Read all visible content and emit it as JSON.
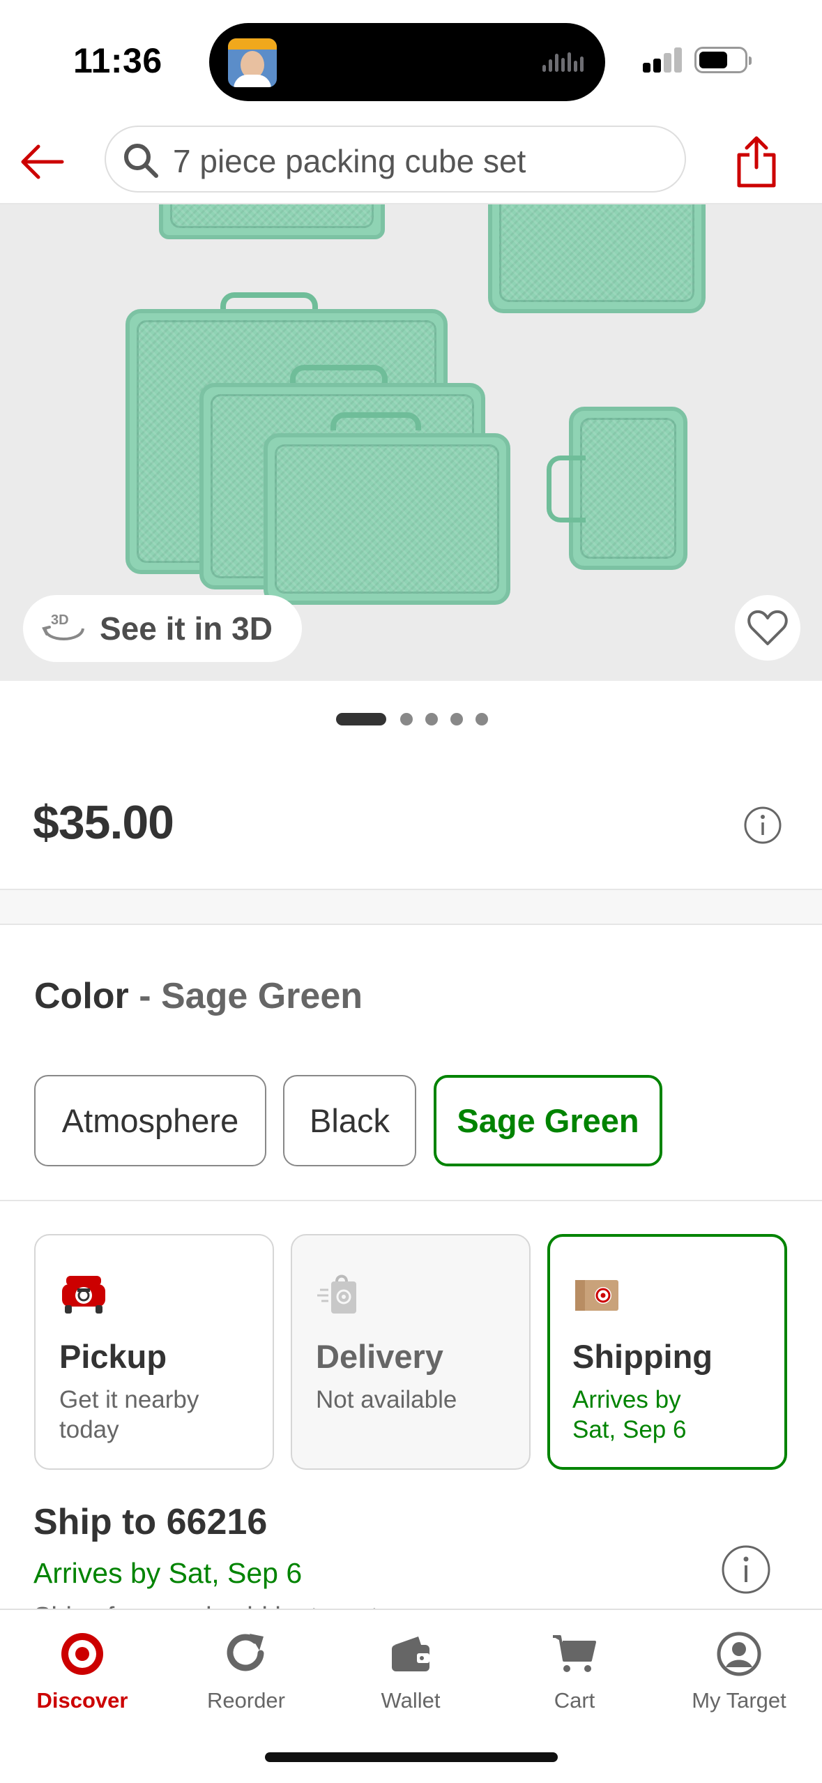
{
  "status_bar": {
    "time": "11:36"
  },
  "header": {
    "search_query": "7 piece packing cube set"
  },
  "product": {
    "see_3d_label": "See it in 3D",
    "carousel": {
      "count": 5,
      "active_index": 0
    },
    "price": "$35.00"
  },
  "color": {
    "label": "Color",
    "separator": "-",
    "selected": "Sage Green",
    "options": [
      "Atmosphere",
      "Black",
      "Sage Green"
    ]
  },
  "fulfillment": {
    "cards": [
      {
        "title": "Pickup",
        "subtitle": "Get it nearby today",
        "state": "available"
      },
      {
        "title": "Delivery",
        "subtitle": "Not available",
        "state": "disabled"
      },
      {
        "title": "Shipping",
        "subtitle": "Arrives by Sat, Sep 6",
        "state": "selected"
      }
    ]
  },
  "ship": {
    "title": "Ship to 66216",
    "arrives": "Arrives by Sat, Sep 6",
    "cut_off_text": "Ships from and sold by target.com"
  },
  "tabs": [
    {
      "label": "Discover",
      "icon": "target-logo-icon",
      "active": true
    },
    {
      "label": "Reorder",
      "icon": "reorder-icon",
      "active": false
    },
    {
      "label": "Wallet",
      "icon": "wallet-icon",
      "active": false
    },
    {
      "label": "Cart",
      "icon": "cart-icon",
      "active": false
    },
    {
      "label": "My Target",
      "icon": "account-icon",
      "active": false
    }
  ],
  "colors": {
    "brand_red": "#cc0000",
    "success_green": "#008300",
    "text_primary": "#333333",
    "text_secondary": "#666666",
    "product_mint": "#8fd3b4"
  }
}
